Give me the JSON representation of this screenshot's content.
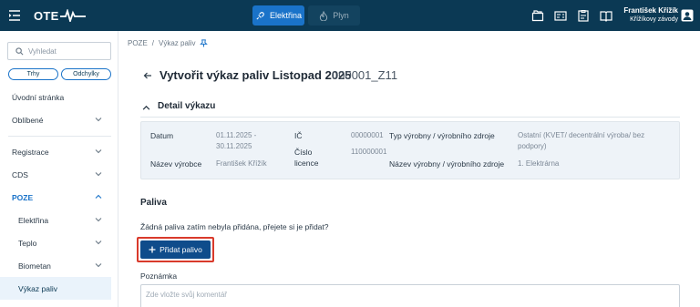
{
  "topbar": {
    "logo_text": "OTE",
    "tabs": [
      {
        "label": "Elektřina",
        "icon": "plug-icon",
        "active": true
      },
      {
        "label": "Plyn",
        "icon": "flame-icon",
        "active": false
      }
    ],
    "icons": [
      "folder-icon",
      "invoice-icon",
      "clipboard-icon",
      "book-icon"
    ],
    "user_name": "František Křížík",
    "company": "Křížíkovy závody"
  },
  "sidebar": {
    "search_placeholder": "Vyhledat",
    "chips": [
      "Trhy",
      "Odchylky"
    ],
    "items": [
      {
        "label": "Úvodní stránka"
      },
      {
        "label": "Oblíbené"
      },
      {
        "label": "Registrace"
      },
      {
        "label": "CDS"
      },
      {
        "label": "POZE"
      },
      {
        "label": "Elektřina"
      },
      {
        "label": "Teplo"
      },
      {
        "label": "Biometan"
      },
      {
        "label": "Výkaz paliv"
      }
    ]
  },
  "breadcrumb": {
    "root": "POZE",
    "separator": "/",
    "current": "Výkaz paliv"
  },
  "page": {
    "title": "Vytvořit výkaz paliv Listopad 2025",
    "code": "000001_Z11",
    "section_title": "Detail výkazu",
    "details": {
      "datum_label": "Datum",
      "datum_value_1": "01.11.2025 -",
      "datum_value_2": "30.11.2025",
      "vyrobce_label": "Název výrobce",
      "vyrobce_value": "František Křížík",
      "ic_label": "IČ",
      "ic_value": "00000001",
      "licence_label_1": "Číslo",
      "licence_label_2": "licence",
      "licence_value": "110000001",
      "typ_label": "Typ výrobny / výrobního zdroje",
      "typ_value_1": "Ostatní (KVET/ decentrální výroba/ bez",
      "typ_value_2": "podpory)",
      "nazev_label": "Název výrobny / výrobního zdroje",
      "nazev_value": "1. Elektrárna"
    },
    "fuels_title": "Paliva",
    "empty_message": "Žádná paliva zatím nebyla přidána, přejete si je přidat?",
    "add_button": "Přidat palivo",
    "note_label": "Poznámka",
    "note_placeholder": "Zde vložte svůj komentář"
  },
  "colors": {
    "topbar": "#0b3954",
    "accent": "#1a73c9",
    "button": "#0f4c8b",
    "highlight": "#d93a2b"
  }
}
